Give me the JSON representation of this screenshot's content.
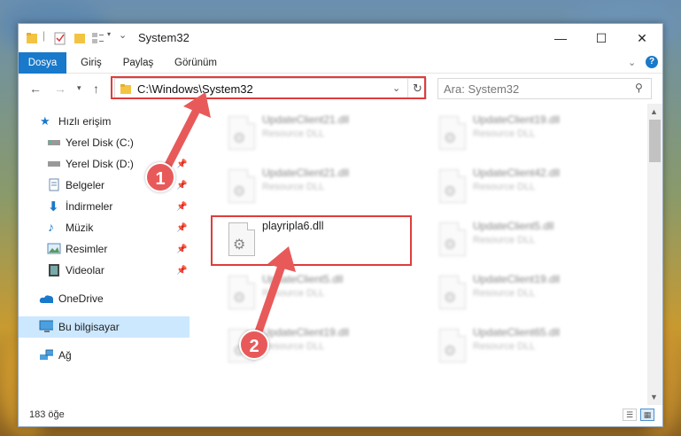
{
  "window": {
    "title": "System32"
  },
  "ribbon": {
    "tabs": [
      "Dosya",
      "Giriş",
      "Paylaş",
      "Görünüm"
    ]
  },
  "nav": {
    "address": "C:\\Windows\\System32",
    "search_placeholder": "Ara: System32"
  },
  "sidebar": {
    "items": [
      {
        "label": "Hızlı erişim",
        "icon": "star-icon"
      },
      {
        "label": "Yerel Disk (C:)",
        "icon": "drive-icon"
      },
      {
        "label": "Yerel Disk (D:)",
        "icon": "drive-icon"
      },
      {
        "label": "Belgeler",
        "icon": "document-icon"
      },
      {
        "label": "İndirmeler",
        "icon": "download-icon"
      },
      {
        "label": "Müzik",
        "icon": "music-icon"
      },
      {
        "label": "Resimler",
        "icon": "picture-icon"
      },
      {
        "label": "Videolar",
        "icon": "video-icon"
      },
      {
        "label": "OneDrive",
        "icon": "cloud-icon"
      },
      {
        "label": "Bu bilgisayar",
        "icon": "computer-icon"
      },
      {
        "label": "Ağ",
        "icon": "network-icon"
      }
    ]
  },
  "files": {
    "left": [
      {
        "name": "UpdateClient21.dll",
        "type": "Resource DLL"
      },
      {
        "name": "UpdateClient21.dll",
        "type": "Resource DLL"
      },
      {
        "name": "playripla6.dll",
        "type": ""
      },
      {
        "name": "UpdateClient5.dll",
        "type": "Resource DLL"
      },
      {
        "name": "UpdateClient19.dll",
        "type": "Resource DLL"
      }
    ],
    "right": [
      {
        "name": "UpdateClient19.dll",
        "type": "Resource DLL"
      },
      {
        "name": "UpdateClient42.dll",
        "type": "Resource DLL"
      },
      {
        "name": "UpdateClient5.dll",
        "type": "Resource DLL"
      },
      {
        "name": "UpdateClient19.dll",
        "type": "Resource DLL"
      },
      {
        "name": "UpdateClient65.dll",
        "type": "Resource DLL"
      }
    ]
  },
  "status": {
    "count": "183 öğe"
  },
  "annotations": {
    "badge1": "1",
    "badge2": "2",
    "color": "#e03c3c"
  }
}
